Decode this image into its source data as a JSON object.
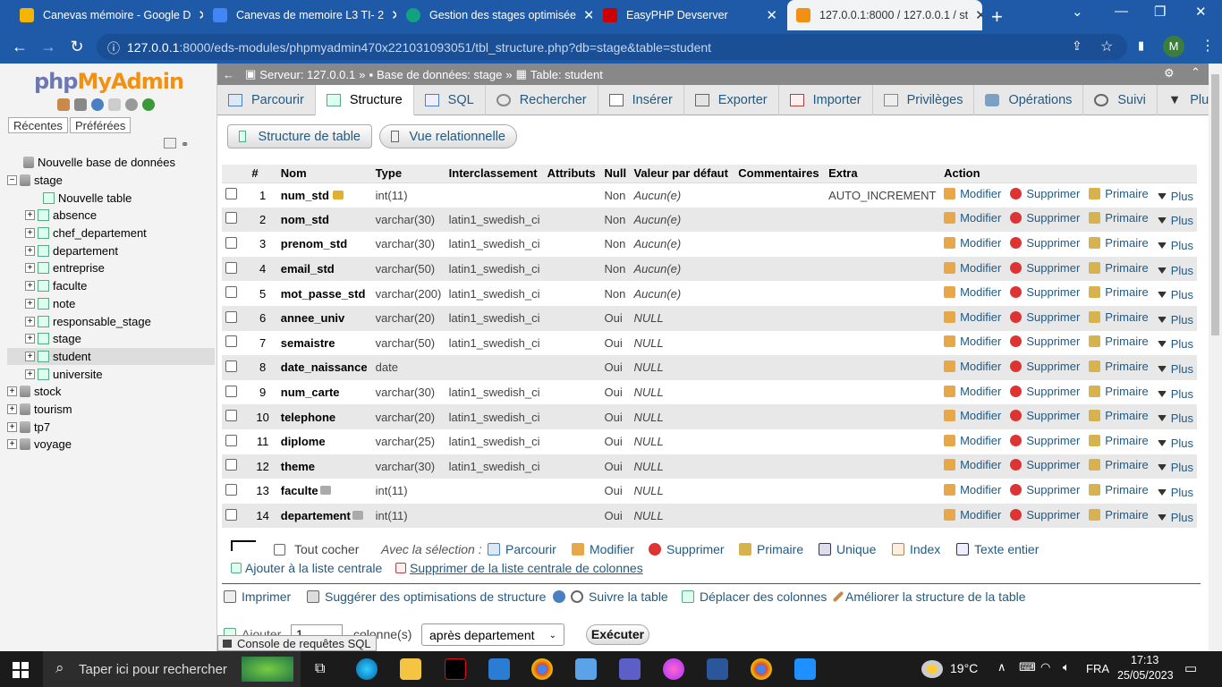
{
  "browser": {
    "tabs": [
      {
        "title": "Canevas mémoire - Google D",
        "favicon_color": "#f4b400"
      },
      {
        "title": "Canevas de memoire L3 TI- 2",
        "favicon_color": "#4285f4"
      },
      {
        "title": "Gestion des stages optimisée",
        "favicon_color": "#10a37f"
      },
      {
        "title": "EasyPHP Devserver",
        "favicon_color": "#c00"
      },
      {
        "title": "127.0.0.1:8000 / 127.0.0.1 / st",
        "favicon_color": "#f29111",
        "active": true
      }
    ],
    "url_host": "127.0.0.1",
    "url_path": ":8000/eds-modules/phpmyadmin470x221031093051/tbl_structure.php?db=stage&table=student",
    "profile_initial": "M"
  },
  "sidebar": {
    "logo_php": "php",
    "logo_my": "My",
    "logo_admin": "Admin",
    "tab_recent": "Récentes",
    "tab_favorites": "Préférées",
    "new_db": "Nouvelle base de données",
    "db_stage": "stage",
    "new_table": "Nouvelle table",
    "tables": [
      "absence",
      "chef_departement",
      "departement",
      "entreprise",
      "faculte",
      "note",
      "responsable_stage",
      "stage",
      "student",
      "universite"
    ],
    "selected_table": "student",
    "other_dbs": [
      "stock",
      "tourism",
      "tp7",
      "voyage"
    ]
  },
  "breadcrumb": {
    "server": "Serveur: 127.0.0.1",
    "database": "Base de données: stage",
    "table": "Table: student"
  },
  "menu_tabs": [
    "Parcourir",
    "Structure",
    "SQL",
    "Rechercher",
    "Insérer",
    "Exporter",
    "Importer",
    "Privilèges",
    "Opérations",
    "Suivi",
    "Plus"
  ],
  "active_tab": "Structure",
  "sub_tabs": {
    "table_structure": "Structure de table",
    "relational_view": "Vue relationnelle"
  },
  "columns_header": [
    "#",
    "Nom",
    "Type",
    "Interclassement",
    "Attributs",
    "Null",
    "Valeur par défaut",
    "Commentaires",
    "Extra",
    "Action"
  ],
  "rows": [
    {
      "n": "1",
      "name": "num_std",
      "type": "int(11)",
      "collation": "",
      "null": "Non",
      "default": "Aucun(e)",
      "extra": "AUTO_INCREMENT"
    },
    {
      "n": "2",
      "name": "nom_std",
      "type": "varchar(30)",
      "collation": "latin1_swedish_ci",
      "null": "Non",
      "default": "Aucun(e)",
      "extra": ""
    },
    {
      "n": "3",
      "name": "prenom_std",
      "type": "varchar(30)",
      "collation": "latin1_swedish_ci",
      "null": "Non",
      "default": "Aucun(e)",
      "extra": ""
    },
    {
      "n": "4",
      "name": "email_std",
      "type": "varchar(50)",
      "collation": "latin1_swedish_ci",
      "null": "Non",
      "default": "Aucun(e)",
      "extra": ""
    },
    {
      "n": "5",
      "name": "mot_passe_std",
      "type": "varchar(200)",
      "collation": "latin1_swedish_ci",
      "null": "Non",
      "default": "Aucun(e)",
      "extra": ""
    },
    {
      "n": "6",
      "name": "annee_univ",
      "type": "varchar(20)",
      "collation": "latin1_swedish_ci",
      "null": "Oui",
      "default": "NULL",
      "extra": ""
    },
    {
      "n": "7",
      "name": "semaistre",
      "type": "varchar(50)",
      "collation": "latin1_swedish_ci",
      "null": "Oui",
      "default": "NULL",
      "extra": ""
    },
    {
      "n": "8",
      "name": "date_naissance",
      "type": "date",
      "collation": "",
      "null": "Oui",
      "default": "NULL",
      "extra": ""
    },
    {
      "n": "9",
      "name": "num_carte",
      "type": "varchar(30)",
      "collation": "latin1_swedish_ci",
      "null": "Oui",
      "default": "NULL",
      "extra": ""
    },
    {
      "n": "10",
      "name": "telephone",
      "type": "varchar(20)",
      "collation": "latin1_swedish_ci",
      "null": "Oui",
      "default": "NULL",
      "extra": ""
    },
    {
      "n": "11",
      "name": "diplome",
      "type": "varchar(25)",
      "collation": "latin1_swedish_ci",
      "null": "Oui",
      "default": "NULL",
      "extra": ""
    },
    {
      "n": "12",
      "name": "theme",
      "type": "varchar(30)",
      "collation": "latin1_swedish_ci",
      "null": "Oui",
      "default": "NULL",
      "extra": ""
    },
    {
      "n": "13",
      "name": "faculte",
      "type": "int(11)",
      "collation": "",
      "null": "Oui",
      "default": "NULL",
      "extra": ""
    },
    {
      "n": "14",
      "name": "departement",
      "type": "int(11)",
      "collation": "",
      "null": "Oui",
      "default": "NULL",
      "extra": ""
    }
  ],
  "row_actions": {
    "edit": "Modifier",
    "delete": "Supprimer",
    "primary": "Primaire",
    "more": "Plus"
  },
  "bulk": {
    "check_all": "Tout cocher",
    "with_selection": "Avec la sélection :",
    "browse": "Parcourir",
    "edit": "Modifier",
    "delete": "Supprimer",
    "primary": "Primaire",
    "unique": "Unique",
    "index": "Index",
    "fulltext": "Texte entier",
    "add_central": "Ajouter à la liste centrale",
    "remove_central": "Supprimer de la liste centrale de colonnes"
  },
  "footer_links": {
    "print": "Imprimer",
    "suggest": "Suggérer des optimisations de structure",
    "track": "Suivre la table",
    "move": "Déplacer des colonnes",
    "improve": "Améliorer la structure de la table"
  },
  "add_row": {
    "label": "Ajouter",
    "count": "1",
    "columns_label": "colonne(s)",
    "position": "après departement",
    "execute": "Exécuter"
  },
  "console_label": "Console de requêtes SQL",
  "taskbar": {
    "search_placeholder": "Taper ici pour rechercher",
    "weather": "19°C",
    "lang": "FRA",
    "time": "17:13",
    "date": "25/05/2023"
  }
}
